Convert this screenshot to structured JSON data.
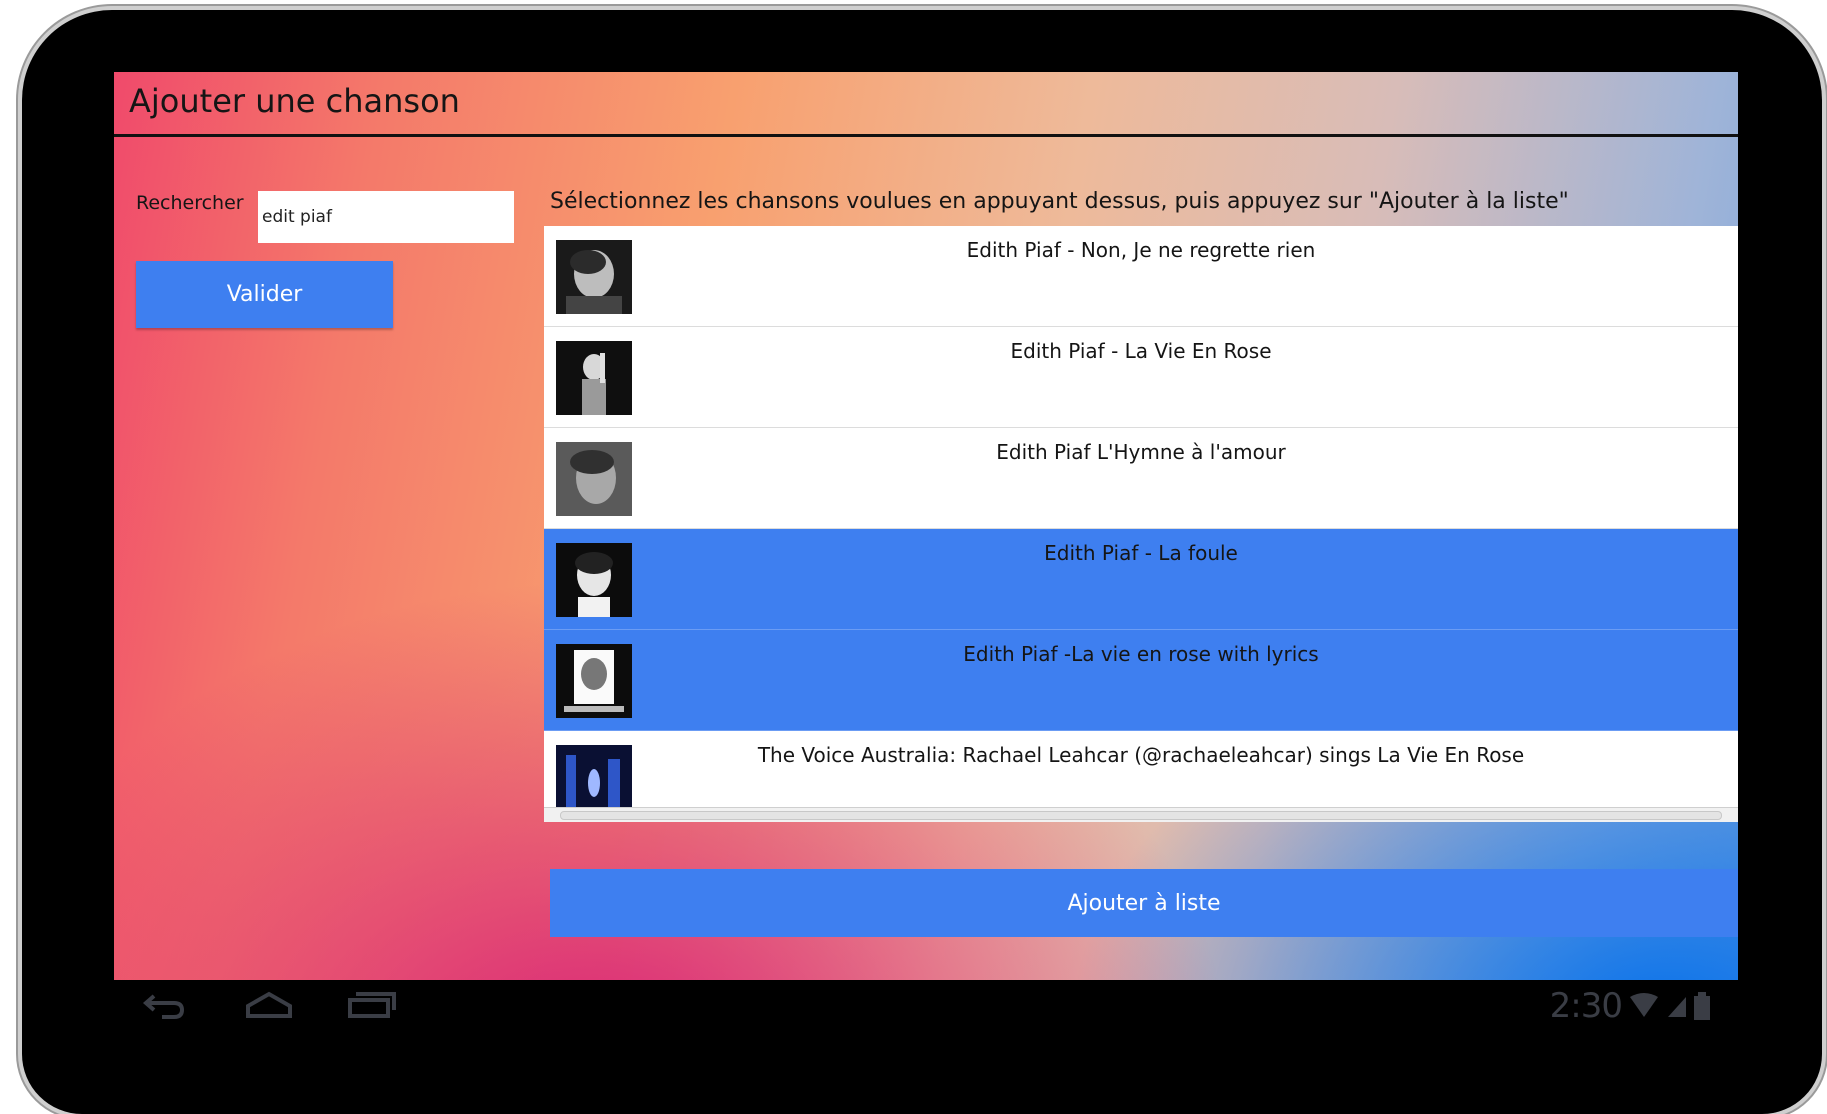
{
  "app": {
    "title": "Ajouter une chanson"
  },
  "search": {
    "label": "Rechercher",
    "value": "edit piaf",
    "validate_label": "Valider"
  },
  "instruction": "Sélectionnez les chansons voulues en appuyant dessus, puis appuyez sur \"Ajouter à la liste\"",
  "songs": [
    {
      "title": "Edith Piaf - Non, Je ne regrette rien",
      "selected": false
    },
    {
      "title": "Edith Piaf - La Vie En Rose",
      "selected": false
    },
    {
      "title": "Edith Piaf L'Hymne à l'amour",
      "selected": false
    },
    {
      "title": "Edith Piaf - La foule",
      "selected": true
    },
    {
      "title": "Edith Piaf -La vie en rose with lyrics",
      "selected": true
    },
    {
      "title": "The Voice Australia: Rachael Leahcar (@rachaeleahcar) sings La Vie En Rose",
      "selected": false
    }
  ],
  "add_button_label": "Ajouter à liste",
  "status_bar": {
    "time": "2:30"
  },
  "colors": {
    "accent": "#3e7ff0",
    "frame": "#000000"
  },
  "icons": {
    "back": "back-icon",
    "home": "home-icon",
    "recent": "recent-apps-icon",
    "wifi": "wifi-icon",
    "signal": "signal-icon",
    "battery": "battery-icon"
  }
}
